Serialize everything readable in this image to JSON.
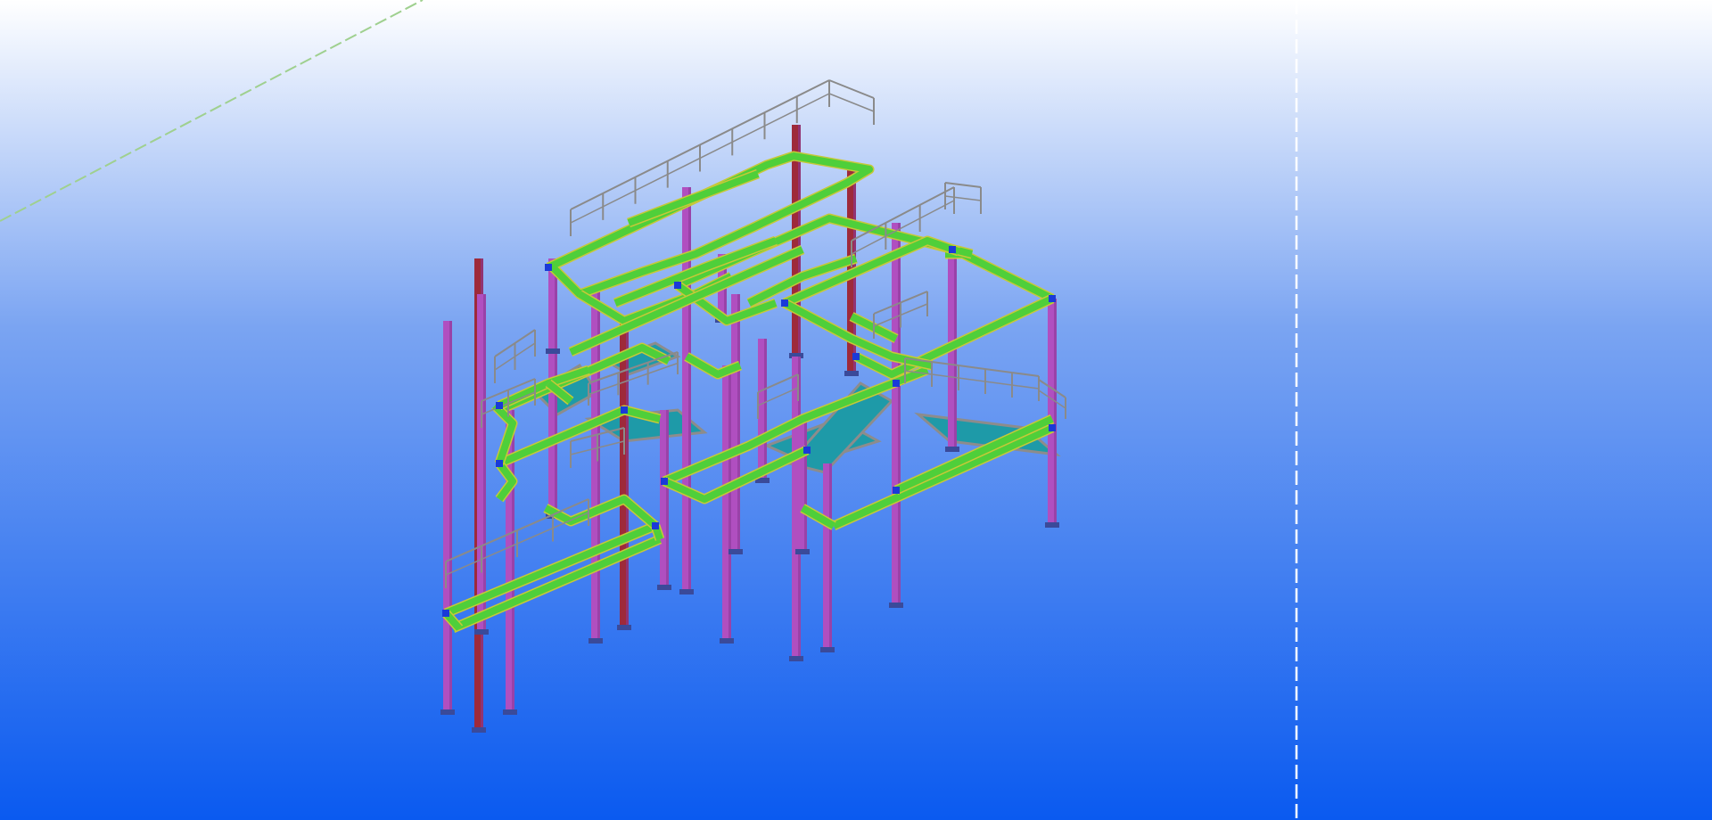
{
  "viewport": {
    "background_top": "#ffffff",
    "background_mid": "#7aa4f2",
    "background_bottom": "#0a5af0"
  },
  "colors": {
    "column": "#b04fc0",
    "column_dark": "#8a3a98",
    "column_red": "#9e2a3a",
    "beam_green": "#4fcf3a",
    "beam_yellow": "#c8c838",
    "railing_grey": "#8a8a8a",
    "stair_cyan": "#1e9aa8",
    "stair_grey": "#8c8c8c",
    "base_plate": "#3a4a9a",
    "joint_blue": "#1a3ad8",
    "grid_green": "#9fd08f",
    "grid_white": "#ffffff"
  },
  "model": {
    "type": "steel-structure-3d-view"
  }
}
